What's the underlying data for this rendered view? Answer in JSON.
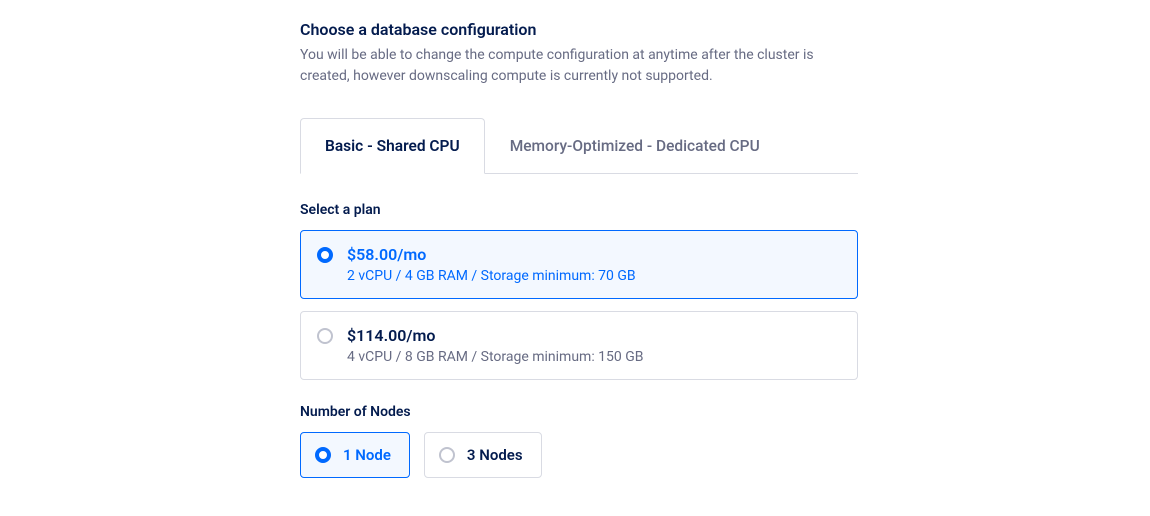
{
  "header": {
    "title": "Choose a database configuration",
    "description": "You will be able to change the compute configuration at anytime after the cluster is created, however downscaling compute is currently not supported."
  },
  "tabs": [
    {
      "label": "Basic - Shared CPU",
      "active": true
    },
    {
      "label": "Memory-Optimized - Dedicated CPU",
      "active": false
    }
  ],
  "plan_section": {
    "label": "Select a plan",
    "plans": [
      {
        "price": "$58.00/mo",
        "specs": "2 vCPU / 4 GB RAM / Storage minimum: 70 GB",
        "selected": true
      },
      {
        "price": "$114.00/mo",
        "specs": "4 vCPU / 8 GB RAM / Storage minimum: 150 GB",
        "selected": false
      }
    ]
  },
  "nodes_section": {
    "label": "Number of Nodes",
    "options": [
      {
        "label": "1 Node",
        "selected": true
      },
      {
        "label": "3 Nodes",
        "selected": false
      }
    ]
  }
}
